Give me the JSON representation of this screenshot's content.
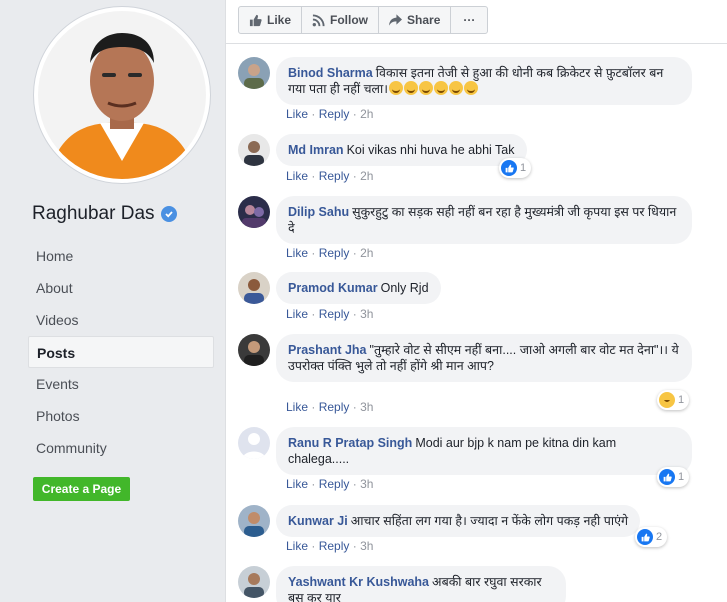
{
  "page": {
    "name": "Raghubar Das",
    "verified": true,
    "nav": [
      {
        "label": "Home",
        "active": false
      },
      {
        "label": "About",
        "active": false
      },
      {
        "label": "Videos",
        "active": false
      },
      {
        "label": "Posts",
        "active": true
      },
      {
        "label": "Events",
        "active": false
      },
      {
        "label": "Photos",
        "active": false
      },
      {
        "label": "Community",
        "active": false
      }
    ],
    "create_page_label": "Create a Page"
  },
  "actions": {
    "like": "Like",
    "follow": "Follow",
    "share": "Share",
    "more": "···"
  },
  "colors": {
    "link": "#385898",
    "bubble": "#f2f3f5",
    "create_button": "#42b72a",
    "like_blue": "#1877f2"
  },
  "comment_actions": {
    "like": "Like",
    "reply": "Reply",
    "sep": "·"
  },
  "comments": [
    {
      "author": "Binod Sharma",
      "text": "विकास इतना तेजी से हुआ की धोनी कब क्रिकेटर से फ़ुटबॉलर बन गया पता ही नहीं चला।",
      "emoji_count": 6,
      "time": "2h",
      "reaction": null
    },
    {
      "author": "Md Imran",
      "text": "Koi vikas nhi huva he abhi Tak",
      "time": "2h",
      "reaction": {
        "type": "like",
        "count": "1"
      }
    },
    {
      "author": "Dilip Sahu",
      "text": "सुकुरहुटु का सड़क सही नहीं बन रहा है मुख्यमंत्री जी कृपया इस पर धियान दे",
      "time": "2h",
      "reaction": null
    },
    {
      "author": "Pramod Kumar",
      "text": "Only Rjd",
      "time": "3h",
      "reaction": null
    },
    {
      "author": "Prashant Jha",
      "text": "\"तुम्हारे वोट से सीएम नहीं बना.... जाओ अगली बार वोट मत देना\"।। ये उपरोक्त पंक्ति भुले तो नहीं होंगे श्री मान आप?",
      "time": "3h",
      "reaction": {
        "type": "haha",
        "count": "1"
      }
    },
    {
      "author": "Ranu R Pratap Singh",
      "text": "Modi aur bjp k nam pe kitna din kam chalega.....",
      "time": "3h",
      "reaction": {
        "type": "like",
        "count": "1"
      }
    },
    {
      "author": "Kunwar Ji",
      "text": "आचार सहिंता लग गया है। ज्यादा न फेंके लोग पकड़ नही पाएंगे",
      "time": "3h",
      "reaction": {
        "type": "like",
        "count": "2"
      }
    },
    {
      "author": "Yashwant Kr Kushwaha",
      "text": "अबकी बार रघुवा सरकार बस कर यार",
      "time": "",
      "reaction": null
    }
  ]
}
